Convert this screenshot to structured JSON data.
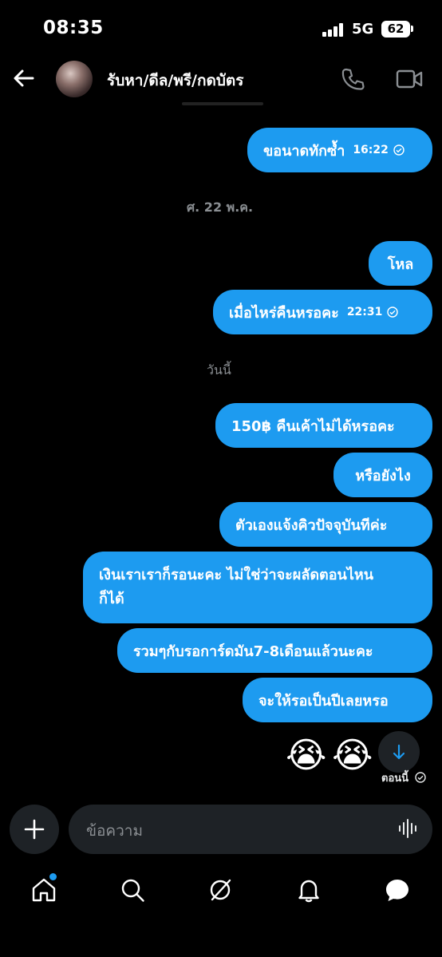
{
  "status_bar": {
    "time": "08:35",
    "network": "5G",
    "battery": "62"
  },
  "header": {
    "contact_name": "รับหา/ดีล/พรี/กดบัตร",
    "back_icon": "back-arrow-icon",
    "call_icon": "phone-icon",
    "video_icon": "video-icon"
  },
  "messages": [
    {
      "text": "ขอนาดทักซ้ำ",
      "time": "16:22"
    },
    {
      "text": "โหล"
    },
    {
      "text": "เมื่อไหร่คืนหรอคะ",
      "time": "22:31"
    },
    {
      "text": "150฿ คืนเค้าไม่ได้หรอคะ"
    },
    {
      "text": "หรือยังไง"
    },
    {
      "text": "ตัวเองแจ้งคิวปัจจุบันทีค่ะ"
    },
    {
      "text_line1": "เงินเราเราก็รอนะคะ ไม่ใช่ว่าจะผลัดตอนไหน",
      "text_line2": "ก็ได้"
    },
    {
      "text": "รวมๆกับรอการ์ดมัน7-8เดือนแล้วนะคะ"
    },
    {
      "text": "จะให้รอเป็นปีเลยหรอ"
    }
  ],
  "date_labels": {
    "fri": "ศ. 22 พ.ค.",
    "today": "วันนี้"
  },
  "emojis": [
    "😭",
    "😭"
  ],
  "seen_label": "ตอนนี้",
  "composer": {
    "placeholder": "ข้อความ"
  },
  "colors": {
    "bubble": "#1d9bf0",
    "background": "#000000",
    "muted": "#8b8f93"
  },
  "nav": [
    "home-icon",
    "search-icon",
    "grok-icon",
    "notifications-icon",
    "messages-icon"
  ]
}
